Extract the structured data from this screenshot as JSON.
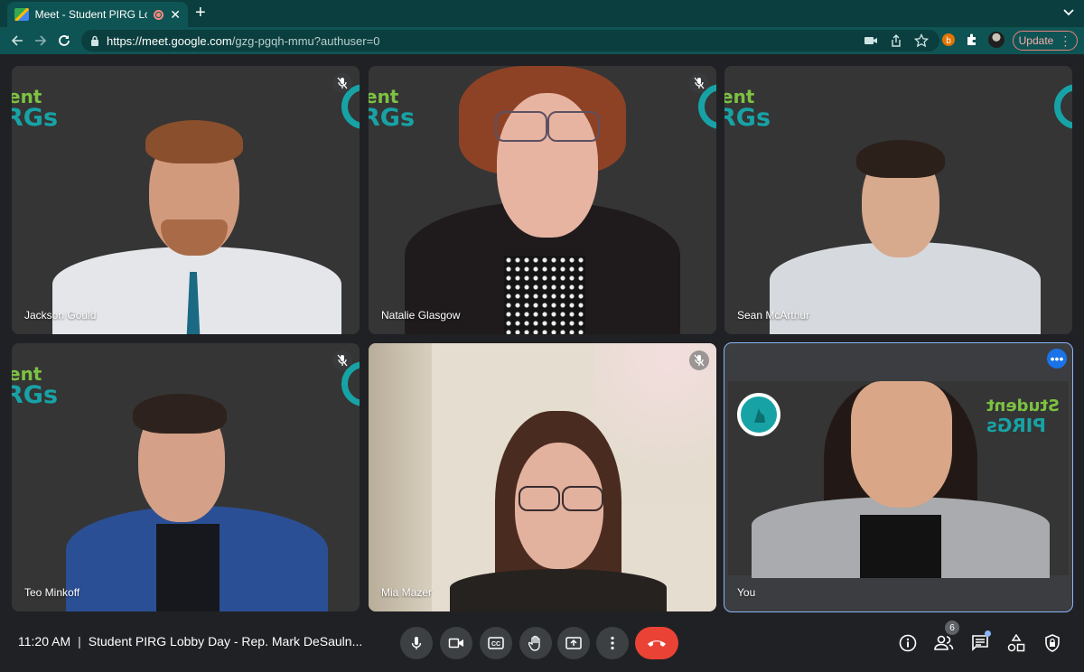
{
  "browser": {
    "tab_title": "Meet - Student PIRG Lobby",
    "url_host": "https://meet.google.com",
    "url_path": "/gzg-pgqh-mmu?authuser=0",
    "update_label": "Update"
  },
  "participants": [
    {
      "name": "Jackson Gould",
      "muted": true
    },
    {
      "name": "Natalie Glasgow",
      "muted": true
    },
    {
      "name": "Sean McArthur",
      "muted": false
    },
    {
      "name": "Teo Minkoff",
      "muted": true
    },
    {
      "name": "Mia Mazer",
      "muted": true
    },
    {
      "name": "You",
      "muted": false
    }
  ],
  "background_brand": {
    "line1": "ent",
    "line2": "RGs",
    "self_line1": "Student",
    "self_line2": "PIRGs"
  },
  "meeting": {
    "time": "11:20 AM",
    "separator": "|",
    "title": "Student PIRG Lobby Day - Rep. Mark DeSauln..."
  },
  "people_count": "6",
  "icons": [
    "mic-icon",
    "camera-icon",
    "captions-icon",
    "raise-hand-icon",
    "present-icon",
    "more-options-icon",
    "end-call-icon",
    "info-icon",
    "people-icon",
    "chat-icon",
    "activities-icon",
    "host-controls-icon"
  ]
}
